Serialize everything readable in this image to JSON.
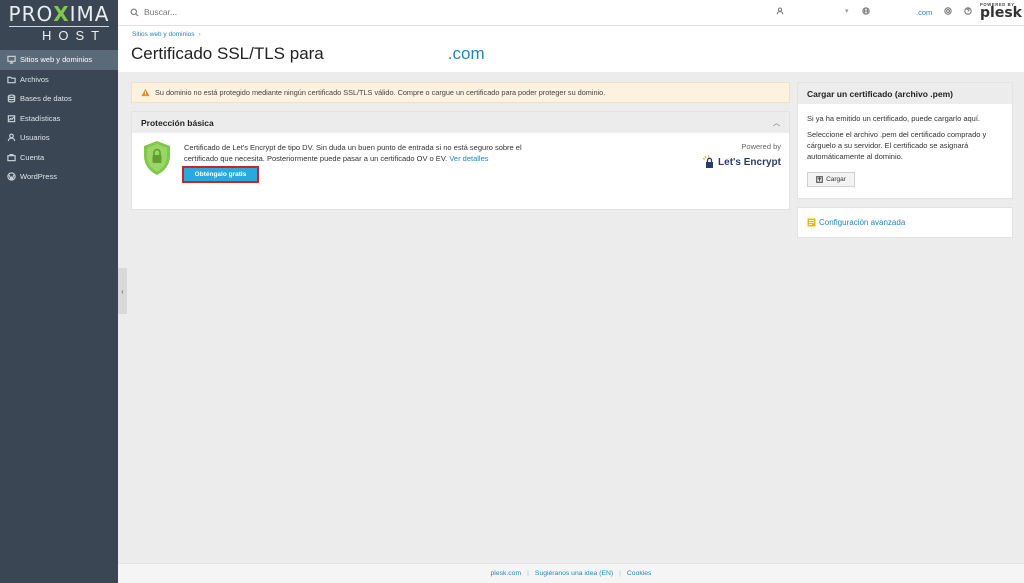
{
  "brand": {
    "logo_part1": "PRO",
    "logo_x": "X",
    "logo_part2": "IMA",
    "logo_sub": "HOST"
  },
  "sidebar": {
    "items": [
      {
        "label": "Sitios web y dominios",
        "icon": "monitor-icon"
      },
      {
        "label": "Archivos",
        "icon": "folder-icon"
      },
      {
        "label": "Bases de datos",
        "icon": "database-icon"
      },
      {
        "label": "Estadísticas",
        "icon": "stats-icon"
      },
      {
        "label": "Usuarios",
        "icon": "user-icon"
      },
      {
        "label": "Cuenta",
        "icon": "briefcase-icon"
      },
      {
        "label": "WordPress",
        "icon": "wordpress-icon"
      }
    ],
    "collapse_glyph": "‹"
  },
  "header": {
    "search_placeholder": "Buscar...",
    "domain": ".com",
    "powered_by": "POWERED BY",
    "plesk": "plesk"
  },
  "page": {
    "breadcrumb": "Sitios web y dominios",
    "title": "Certificado SSL/TLS para",
    "title_domain": ".com"
  },
  "alert": {
    "text": "Su dominio no está protegido mediante ningún certificado SSL/TLS válido. Compre o cargue un certificado para poder proteger su dominio."
  },
  "basic": {
    "heading": "Protección básica",
    "description": "Certificado de Let's Encrypt de tipo DV. Sin duda un buen punto de entrada si no está seguro sobre el certificado que necesita. Posteriormente puede pasar a un certificado OV o EV.",
    "details_link": "Ver detalles",
    "button": "Obténgalo gratis",
    "powered_by": "Powered by",
    "provider": "Let's Encrypt"
  },
  "upload": {
    "heading": "Cargar un certificado (archivo .pem)",
    "p1": "Si ya ha emitido un certificado, puede cargarlo aquí.",
    "p2": "Seleccione el archivo .pem del certificado comprado y cárguelo a su servidor. El certificado se asignará automáticamente al dominio.",
    "button": "Cargar"
  },
  "advanced": {
    "label": "Configuración avanzada"
  },
  "footer": {
    "links": [
      "plesk.com",
      "Sugiéranos una idea (EN)",
      "Cookies"
    ]
  },
  "colors": {
    "sidebar": "#3a4654",
    "link": "#2186bd",
    "primary_button": "#29a9df",
    "alert_bg": "#fdf1e0",
    "shield": "#7fc84a"
  }
}
